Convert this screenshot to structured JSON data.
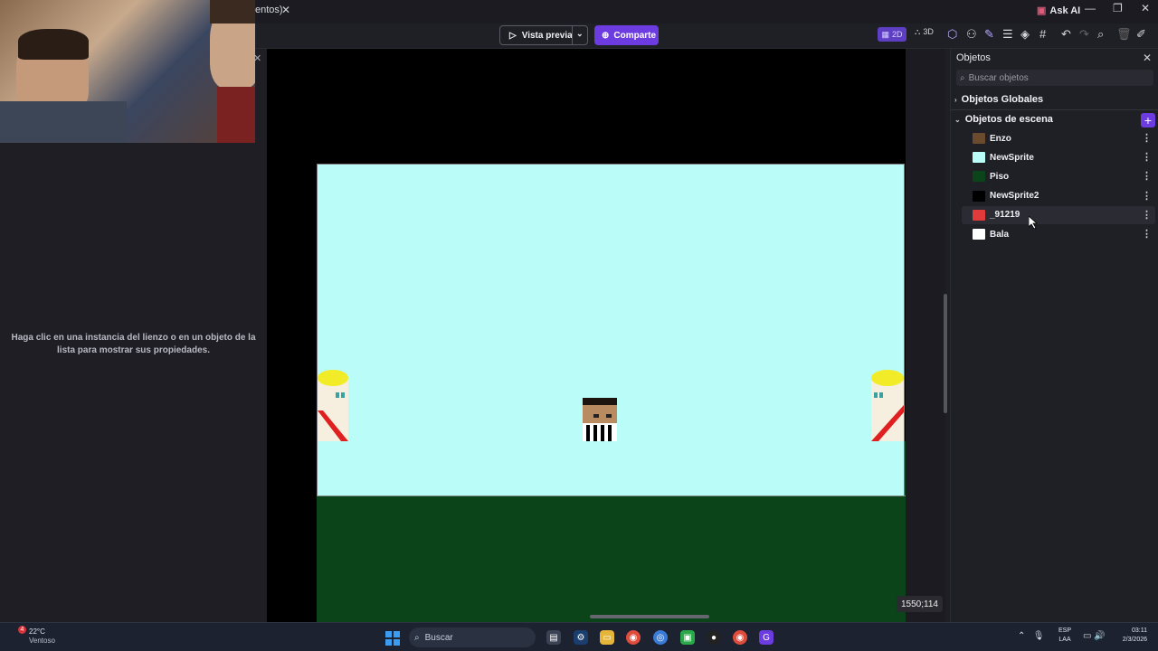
{
  "titlebar": {
    "tab_label": "entos)",
    "ask_ai": "Ask AI"
  },
  "toolbar": {
    "preview_label": "Vista previa",
    "share_label": "Comparte",
    "mode_2d": "2D",
    "mode_3d": "3D"
  },
  "properties": {
    "empty_message": "Haga clic en una instancia del lienzo o en un objeto de la lista para mostrar sus propiedades."
  },
  "canvas": {
    "coords": "1550;114",
    "sky_color": "#b9fcf8",
    "ground_color": "#0b4418"
  },
  "objects_panel": {
    "title": "Objetos",
    "search_placeholder": "Buscar objetos",
    "global_section": "Objetos Globales",
    "scene_section": "Objetos de escena",
    "objects": [
      {
        "name": "Enzo",
        "color": "#6b4a2e"
      },
      {
        "name": "NewSprite",
        "color": "#b9fcf8"
      },
      {
        "name": "Piso",
        "color": "#0b4418"
      },
      {
        "name": "NewSprite2",
        "color": "#000000"
      },
      {
        "name": "_91219",
        "color": "#e03a3a"
      },
      {
        "name": "Bala",
        "color": "#ffffff"
      }
    ]
  },
  "taskbar": {
    "weather_badge": "4",
    "temperature": "22°C",
    "condition": "Ventoso",
    "search_label": "Buscar",
    "lang_top": "ESP",
    "lang_bottom": "LAA",
    "time": "03:11",
    "date": "2/3/2026"
  },
  "accent_color": "#6c3ce0"
}
